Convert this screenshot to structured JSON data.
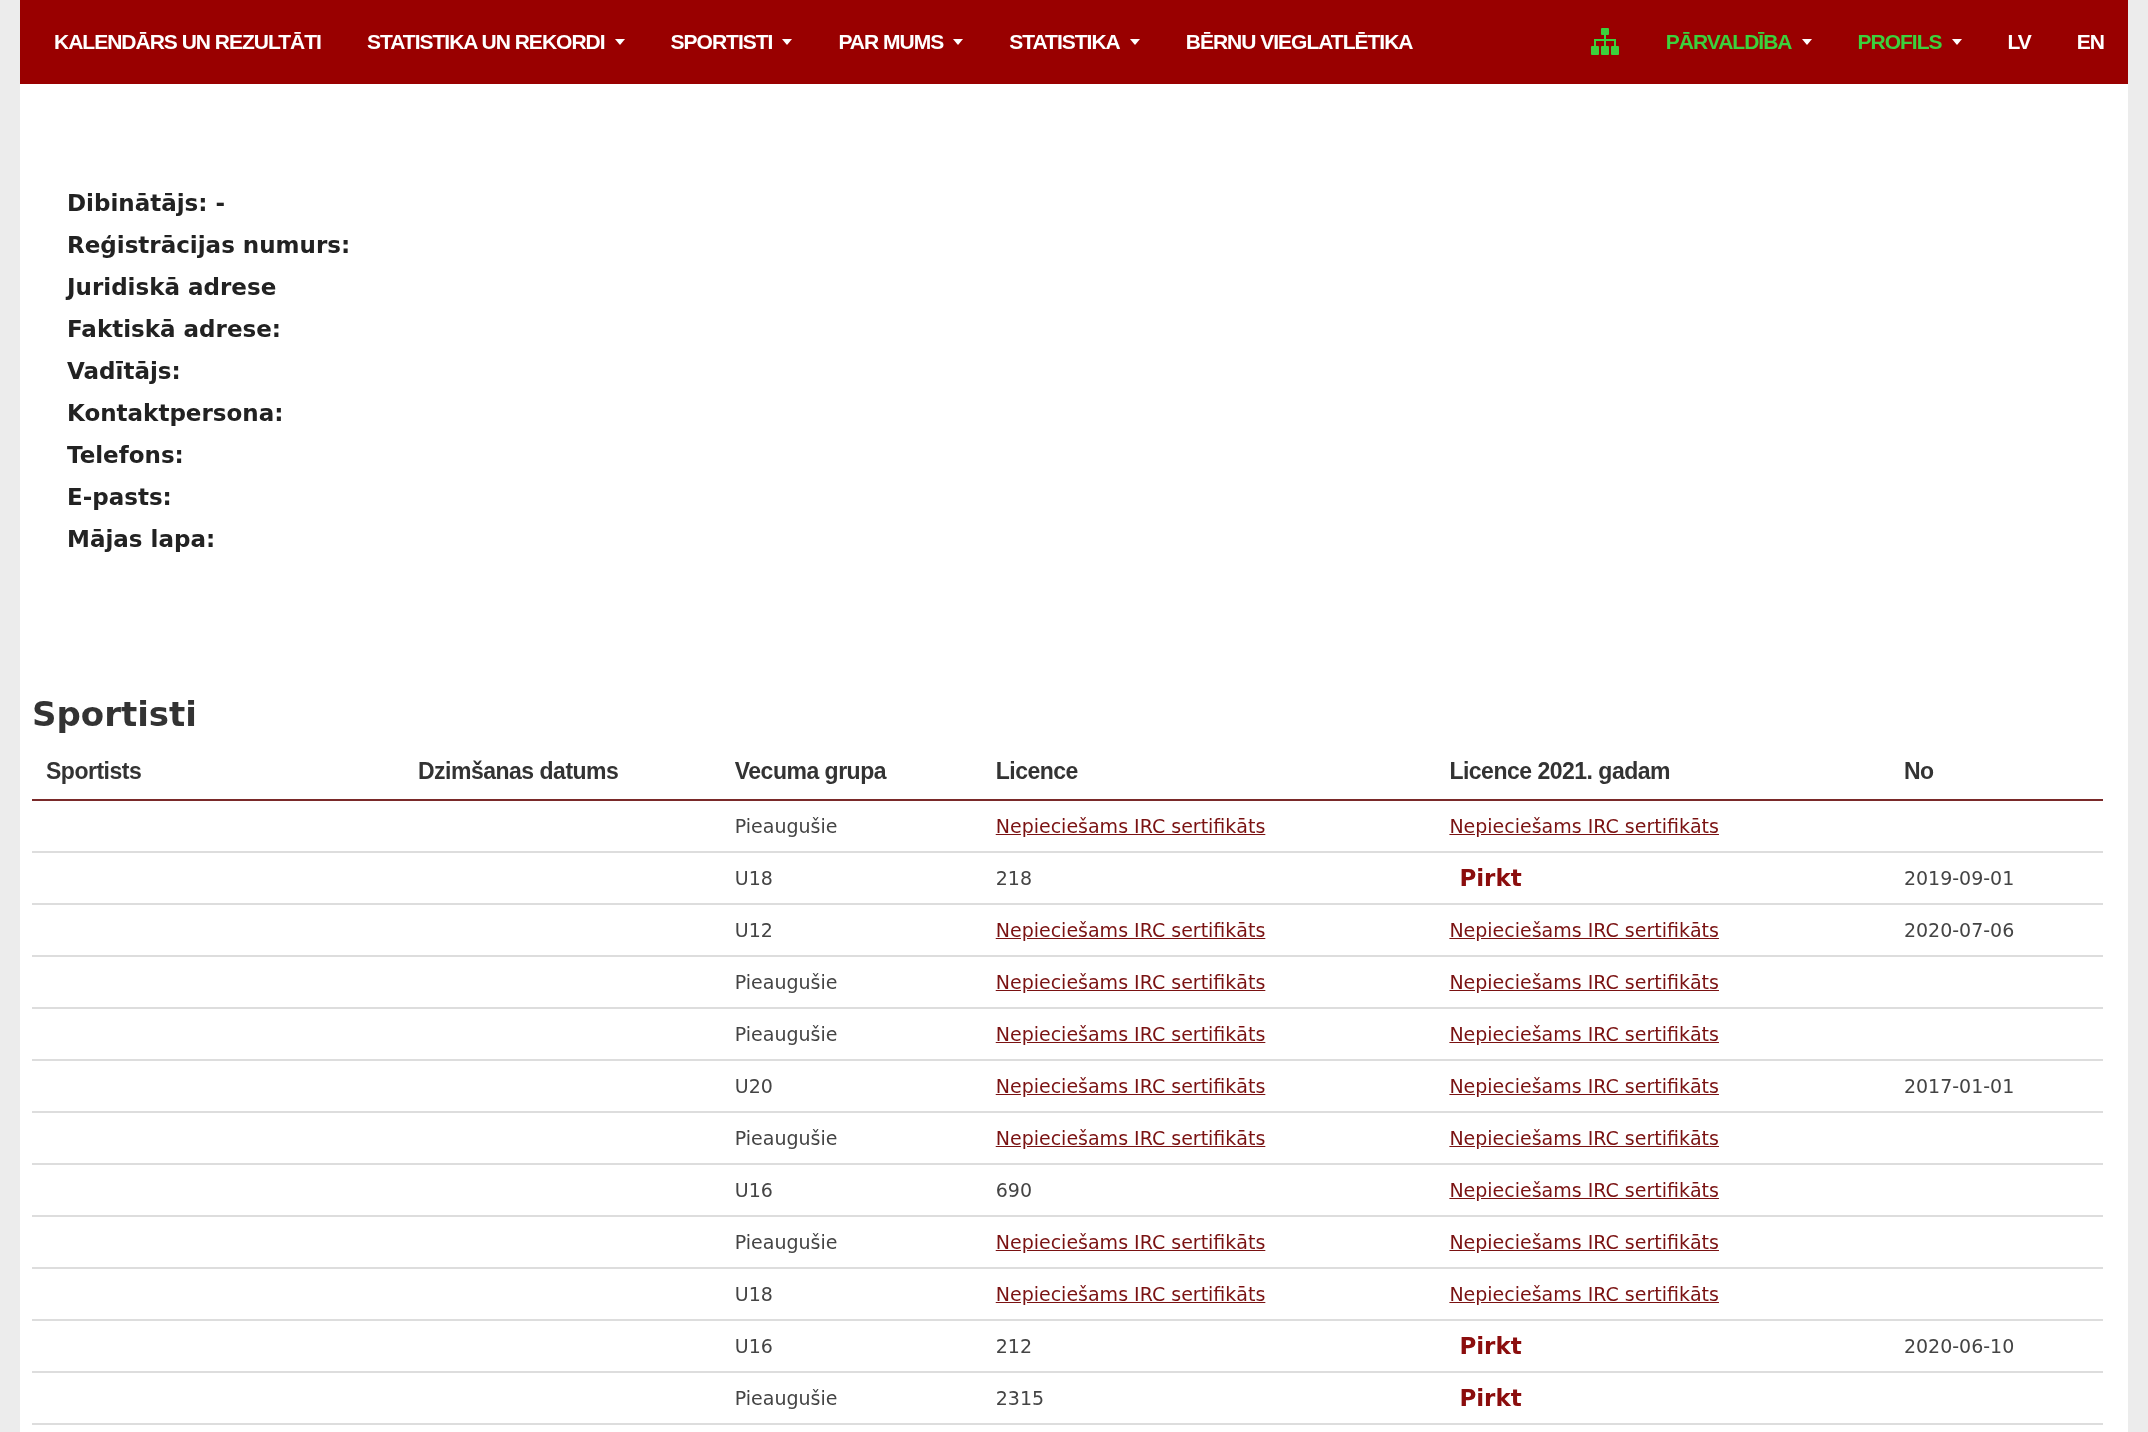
{
  "nav": {
    "items": [
      {
        "label": "KALENDĀRS UN REZULTĀTI",
        "dropdown": false
      },
      {
        "label": "STATISTIKA UN REKORDI",
        "dropdown": true
      },
      {
        "label": "SPORTISTI",
        "dropdown": true
      },
      {
        "label": "PAR MUMS",
        "dropdown": true
      },
      {
        "label": "STATISTIKA",
        "dropdown": true
      },
      {
        "label": "BĒRNU VIEGLATLĒTIKA",
        "dropdown": false
      }
    ],
    "right_items": [
      {
        "label": "PĀRVALDĪBA",
        "dropdown": true,
        "highlighted": true
      },
      {
        "label": "PROFILS",
        "dropdown": true,
        "highlighted": true
      },
      {
        "label": "LV",
        "dropdown": false,
        "highlighted": false
      },
      {
        "label": "EN",
        "dropdown": false,
        "highlighted": false
      }
    ]
  },
  "info": [
    "Dibinātājs: -",
    "Reģistrācijas numurs:",
    "Juridiskā adrese",
    "Faktiskā adrese:",
    "Vadītājs:",
    "Kontaktpersona:",
    "Telefons:",
    "E-pasts:",
    "Mājas lapa:"
  ],
  "section_title": "Sportisti",
  "table": {
    "columns": [
      "Sportists",
      "Dzimšanas datums",
      "Vecuma grupa",
      "Licence",
      "Licence 2021. gadam",
      "No"
    ],
    "rows": [
      {
        "age_group": "Pieaugušie",
        "licence": {
          "kind": "link",
          "text": "Nepieciešams IRC sertifikāts"
        },
        "licence_2021": {
          "kind": "link",
          "text": "Nepieciešams IRC sertifikāts"
        }
      },
      {
        "age_group": "U18",
        "licence": {
          "kind": "text",
          "text": "218"
        },
        "licence_2021": {
          "kind": "buy",
          "text": "Pirkt"
        },
        "from": "2019-09-01"
      },
      {
        "age_group": "U12",
        "licence": {
          "kind": "link",
          "text": "Nepieciešams IRC sertifikāts"
        },
        "licence_2021": {
          "kind": "link",
          "text": "Nepieciešams IRC sertifikāts"
        },
        "from": "2020-07-06"
      },
      {
        "age_group": "Pieaugušie",
        "licence": {
          "kind": "link",
          "text": "Nepieciešams IRC sertifikāts"
        },
        "licence_2021": {
          "kind": "link",
          "text": "Nepieciešams IRC sertifikāts"
        }
      },
      {
        "age_group": "Pieaugušie",
        "licence": {
          "kind": "link",
          "text": "Nepieciešams IRC sertifikāts"
        },
        "licence_2021": {
          "kind": "link",
          "text": "Nepieciešams IRC sertifikāts"
        }
      },
      {
        "age_group": "U20",
        "licence": {
          "kind": "link",
          "text": "Nepieciešams IRC sertifikāts"
        },
        "licence_2021": {
          "kind": "link",
          "text": "Nepieciešams IRC sertifikāts"
        },
        "from": "2017-01-01"
      },
      {
        "age_group": "Pieaugušie",
        "licence": {
          "kind": "link",
          "text": "Nepieciešams IRC sertifikāts"
        },
        "licence_2021": {
          "kind": "link",
          "text": "Nepieciešams IRC sertifikāts"
        }
      },
      {
        "age_group": "U16",
        "licence": {
          "kind": "text",
          "text": "690"
        },
        "licence_2021": {
          "kind": "link",
          "text": "Nepieciešams IRC sertifikāts"
        }
      },
      {
        "age_group": "Pieaugušie",
        "licence": {
          "kind": "link",
          "text": "Nepieciešams IRC sertifikāts"
        },
        "licence_2021": {
          "kind": "link",
          "text": "Nepieciešams IRC sertifikāts"
        }
      },
      {
        "age_group": "U18",
        "licence": {
          "kind": "link",
          "text": "Nepieciešams IRC sertifikāts"
        },
        "licence_2021": {
          "kind": "link",
          "text": "Nepieciešams IRC sertifikāts"
        }
      },
      {
        "age_group": "U16",
        "licence": {
          "kind": "text",
          "text": "212"
        },
        "licence_2021": {
          "kind": "buy",
          "text": "Pirkt"
        },
        "from": "2020-06-10"
      },
      {
        "age_group": "Pieaugušie",
        "licence": {
          "kind": "text",
          "text": "2315"
        },
        "licence_2021": {
          "kind": "buy",
          "text": "Pirkt"
        }
      }
    ]
  }
}
